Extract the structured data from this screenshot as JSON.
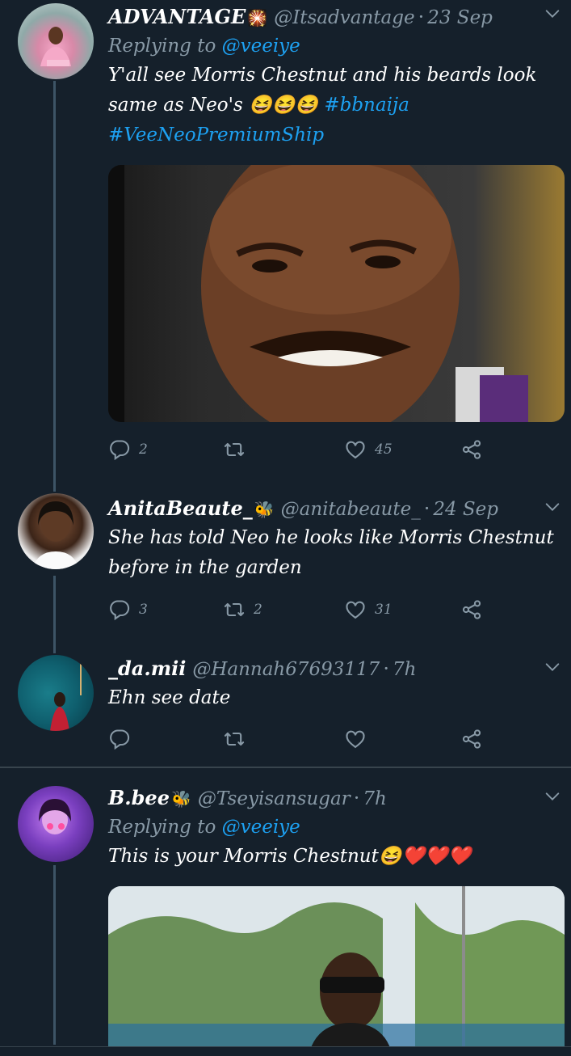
{
  "tweets": [
    {
      "name": "ADVANTAGE",
      "name_emoji": "🎇",
      "handle": "@Itsadvantage",
      "separator": "·",
      "time": "23 Sep",
      "replying_label": "Replying to",
      "replying_handle": "@veeiye",
      "text_line1": "Y'all see Morris Chestnut and his beards look",
      "text_line2_a": "same as Neo's",
      "text_line2_emoji": "😆😆😆",
      "hashtag1": "#bbnaija",
      "hashtag2": "#VeeNeoPremiumShip",
      "replies": "2",
      "retweets": "",
      "likes": "45"
    },
    {
      "name": "AnitaBeaute_",
      "name_emoji": "🐝",
      "handle": "@anitabeaute_",
      "separator": "·",
      "time": "24 Sep",
      "text_line1": "She has told Neo he looks like Morris Chestnut",
      "text_line2": "before in the garden",
      "replies": "3",
      "retweets": "2",
      "likes": "31"
    },
    {
      "name": "_da.mii",
      "handle": "@Hannah67693117",
      "separator": "·",
      "time": "7h",
      "text_line1": "Ehn see date",
      "replies": "",
      "retweets": "",
      "likes": ""
    },
    {
      "name": "B.bee",
      "name_emoji": "🐝",
      "handle": "@Tseyisansugar",
      "separator": "·",
      "time": "7h",
      "replying_label": "Replying to",
      "replying_handle": "@veeiye",
      "text_line1": "This is your Morris Chestnut",
      "text_emoji": "😆❤️❤️❤️"
    }
  ],
  "colors": {
    "background": "#15202b",
    "accent": "#1da1f2",
    "muted": "#8899a6",
    "divider": "#38444d"
  },
  "icons": [
    "reply-icon",
    "retweet-icon",
    "like-icon",
    "share-icon",
    "chevron-down-icon"
  ]
}
